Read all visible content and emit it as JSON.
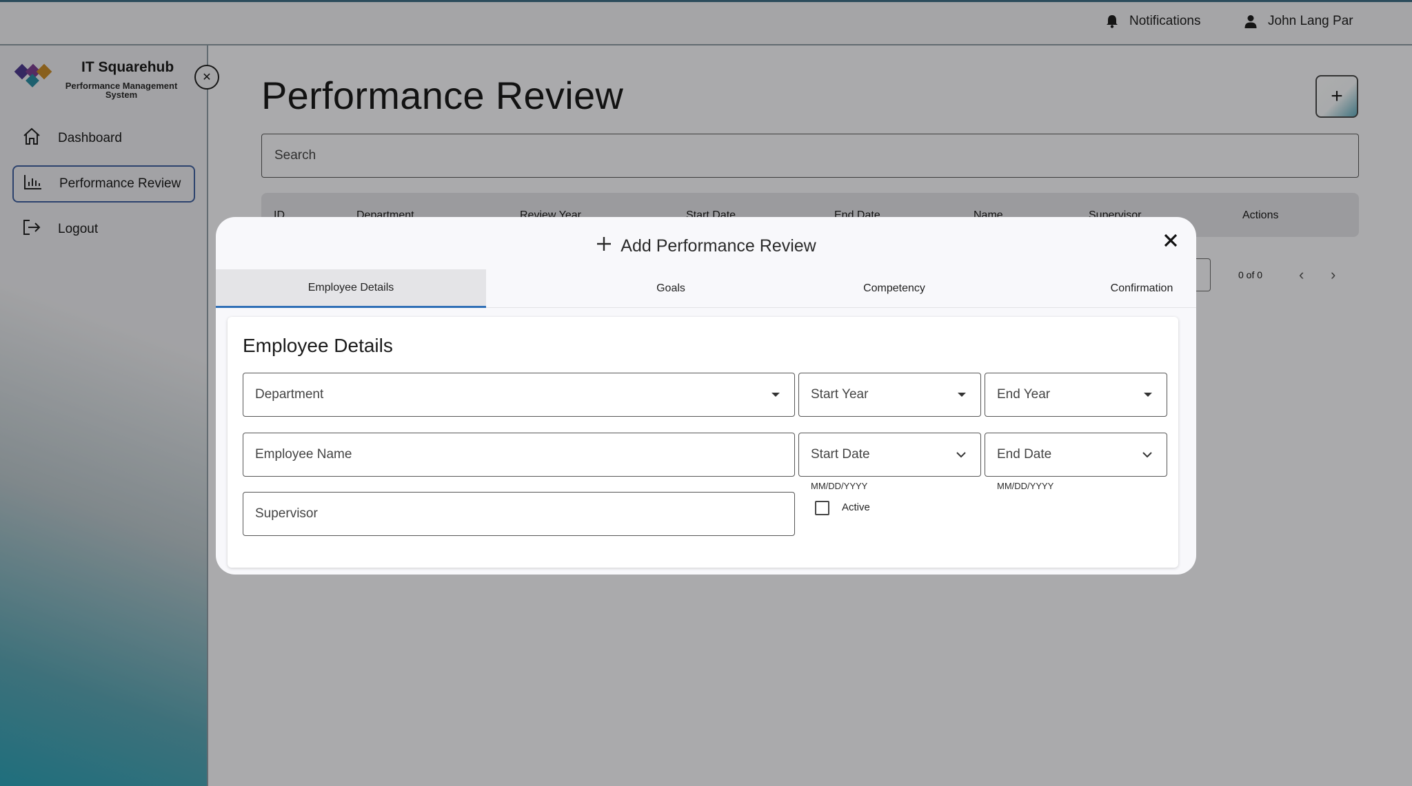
{
  "topbar": {
    "notifications_label": "Notifications",
    "user_name": "John Lang Par",
    "accent_color": "#3f6e84"
  },
  "brand": {
    "name": "IT Squarehub",
    "subtitle": "Performance Management System",
    "logo_colors": [
      "#4d3a8c",
      "#c48a2a",
      "#2a8aa0",
      "#7a3f8f"
    ]
  },
  "sidebar": {
    "items": [
      {
        "label": "Dashboard",
        "icon": "home-icon",
        "active": false
      },
      {
        "label": "Performance Review",
        "icon": "bar-chart-icon",
        "active": true
      },
      {
        "label": "Logout",
        "icon": "logout-icon",
        "active": false
      }
    ]
  },
  "main": {
    "title": "Performance Review",
    "search_placeholder": "Search",
    "table_headers": [
      "ID",
      "Department",
      "Review Year",
      "Start Date",
      "End Date",
      "Name",
      "Supervisor",
      "Actions"
    ],
    "pager_text": "0 of 0"
  },
  "modal": {
    "title": "Add Performance Review",
    "tabs": [
      {
        "label": "Employee Details",
        "active": true
      },
      {
        "label": "Goals",
        "active": false
      },
      {
        "label": "Competency",
        "active": false
      },
      {
        "label": "Confirmation",
        "active": false
      }
    ],
    "section_title": "Employee Details",
    "fields": {
      "department": "Department",
      "start_year": "Start Year",
      "end_year": "End Year",
      "employee_name": "Employee Name",
      "start_date": "Start Date",
      "end_date": "End Date",
      "supervisor": "Supervisor",
      "date_format_hint": "MM/DD/YYYY",
      "active_label": "Active",
      "active_checked": false
    },
    "tab_indicator_color": "#2f6fb6"
  }
}
